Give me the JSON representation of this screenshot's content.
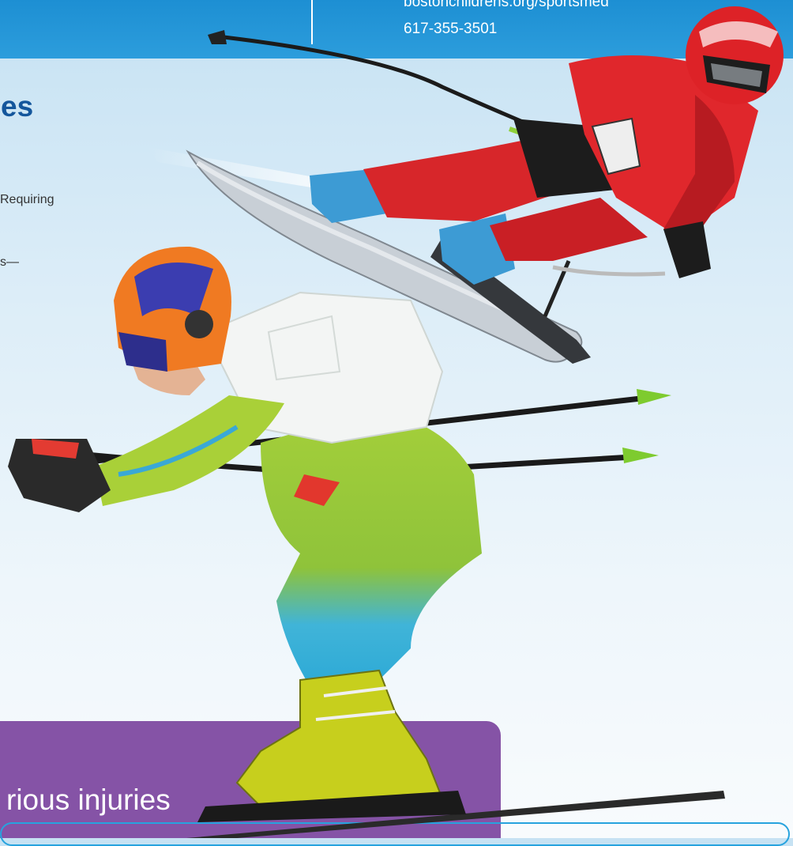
{
  "contact": {
    "url": "bostonchildrens.org/sportsmed",
    "phone": "617-355-3501"
  },
  "section": {
    "heading_fragment": "es"
  },
  "body_fragments": {
    "line1": "Requiring",
    "line2": "s—"
  },
  "callout": {
    "text_fragment": "rious injuries"
  },
  "colors": {
    "header_blue": "#1d8fd3",
    "heading_blue": "#14569c",
    "callout_purple": "#8553a6",
    "outline_blue": "#27a3de"
  },
  "images": {
    "top_skier": "skier-in-red-suit",
    "front_skier": "skier-in-green-and-blue-suit"
  }
}
